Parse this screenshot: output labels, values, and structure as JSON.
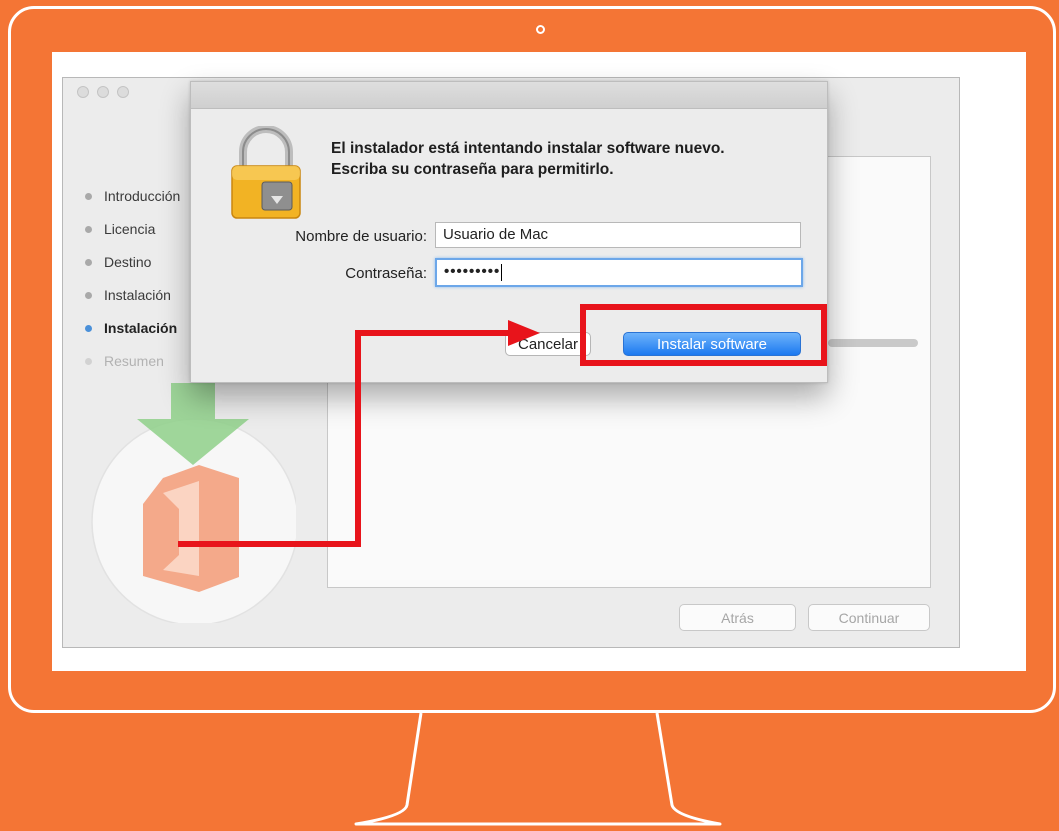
{
  "colors": {
    "background": "#f47535",
    "accent_blue": "#1c79f0",
    "highlight_red": "#e8141b"
  },
  "sidebar": {
    "items": [
      {
        "label": "Introducción"
      },
      {
        "label": "Licencia"
      },
      {
        "label": "Destino"
      },
      {
        "label": "Instalación"
      },
      {
        "label": "Instalación"
      },
      {
        "label": "Resumen"
      }
    ]
  },
  "installer": {
    "back_label": "Atrás",
    "continue_label": "Continuar",
    "logo_icon": "office-icon",
    "download_icon": "arrow-down-icon"
  },
  "dialog": {
    "lock_icon": "lock-icon",
    "message": "El instalador está intentando instalar software nuevo. Escriba su contraseña para permitirlo.",
    "username_label": "Nombre de usuario:",
    "username_value": "Usuario de Mac",
    "password_label": "Contraseña:",
    "password_value": "•••••••••",
    "cancel_label": "Cancelar",
    "install_label": "Instalar software"
  },
  "annotation": {
    "arrow_icon": "arrow-right-icon"
  }
}
